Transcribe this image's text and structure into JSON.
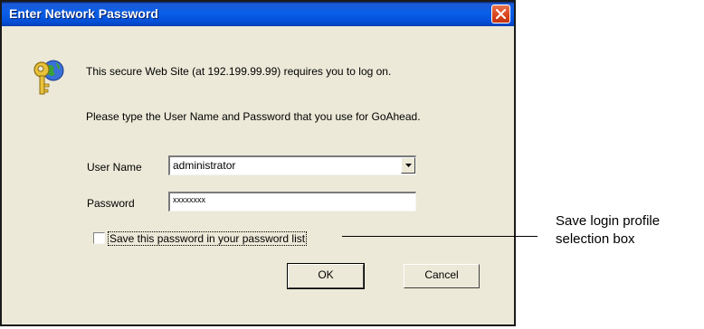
{
  "dialog": {
    "title": "Enter Network Password",
    "message_1": "This secure Web Site (at 192.199.99.99) requires you to log on.",
    "message_2": "Please type the User Name and Password that you use for GoAhead.",
    "username_label": "User Name",
    "username_value": "administrator",
    "password_label": "Password",
    "password_value": "xxxxxxxx",
    "save_checkbox_label": "Save this password in your password list",
    "save_checked": false,
    "ok_label": "OK",
    "cancel_label": "Cancel"
  },
  "annotation": {
    "line1": "Save login profile",
    "line2": "selection box"
  },
  "icons": [
    "close-icon",
    "key-globe-icon",
    "dropdown-arrow-icon"
  ],
  "colors": {
    "titlebar": "#0a5fe8",
    "close_button": "#d8431c",
    "dialog_face": "#ECE9D8"
  }
}
